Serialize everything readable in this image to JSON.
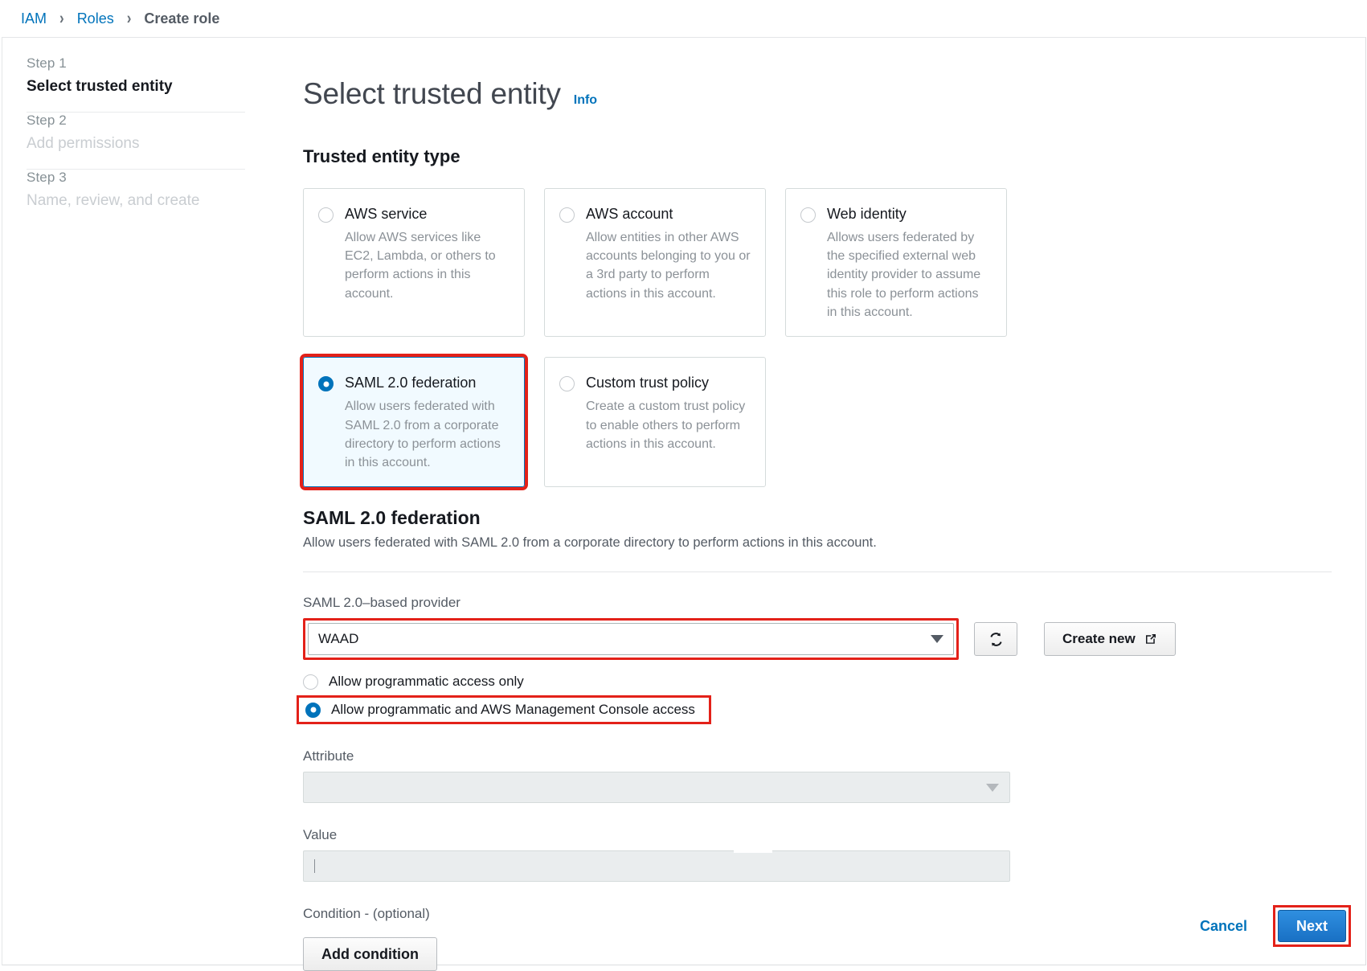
{
  "breadcrumb": {
    "items": [
      {
        "label": "IAM",
        "current": false
      },
      {
        "label": "Roles",
        "current": false
      },
      {
        "label": "Create role",
        "current": true
      }
    ],
    "separator": "›"
  },
  "sidebar": {
    "steps": [
      {
        "number": "Step 1",
        "title": "Select trusted entity",
        "active": true
      },
      {
        "number": "Step 2",
        "title": "Add permissions",
        "active": false
      },
      {
        "number": "Step 3",
        "title": "Name, review, and create",
        "active": false
      }
    ]
  },
  "header": {
    "title": "Select trusted entity",
    "info_label": "Info"
  },
  "trusted_entity_type": {
    "heading": "Trusted entity type",
    "tiles": [
      {
        "label": "AWS service",
        "description": "Allow AWS services like EC2, Lambda, or others to perform actions in this account.",
        "selected": false,
        "highlighted": false
      },
      {
        "label": "AWS account",
        "description": "Allow entities in other AWS accounts belonging to you or a 3rd party to perform actions in this account.",
        "selected": false,
        "highlighted": false
      },
      {
        "label": "Web identity",
        "description": "Allows users federated by the specified external web identity provider to assume this role to perform actions in this account.",
        "selected": false,
        "highlighted": false
      },
      {
        "label": "SAML 2.0 federation",
        "description": "Allow users federated with SAML 2.0 from a corporate directory to perform actions in this account.",
        "selected": true,
        "highlighted": true
      },
      {
        "label": "Custom trust policy",
        "description": "Create a custom trust policy to enable others to perform actions in this account.",
        "selected": false,
        "highlighted": false
      }
    ]
  },
  "saml_section": {
    "heading": "SAML 2.0 federation",
    "description": "Allow users federated with SAML 2.0 from a corporate directory to perform actions in this account.",
    "provider_label": "SAML 2.0–based provider",
    "provider_value": "WAAD",
    "refresh_icon": "refresh-icon",
    "create_new_label": "Create new",
    "external_link_icon": "external-link-icon",
    "access_options": [
      {
        "label": "Allow programmatic access only",
        "selected": false,
        "highlighted": false
      },
      {
        "label": "Allow programmatic and AWS Management Console access",
        "selected": true,
        "highlighted": true
      }
    ],
    "attribute_label": "Attribute",
    "attribute_value": "",
    "value_label": "Value",
    "value_value": "",
    "condition_label": "Condition - (optional)",
    "add_condition_label": "Add condition"
  },
  "footer": {
    "cancel_label": "Cancel",
    "next_label": "Next"
  },
  "colors": {
    "accent_blue": "#0073bb",
    "highlight_red": "#e32119",
    "selected_tile_bg": "#f1faff",
    "button_blue": "#1970c4"
  }
}
